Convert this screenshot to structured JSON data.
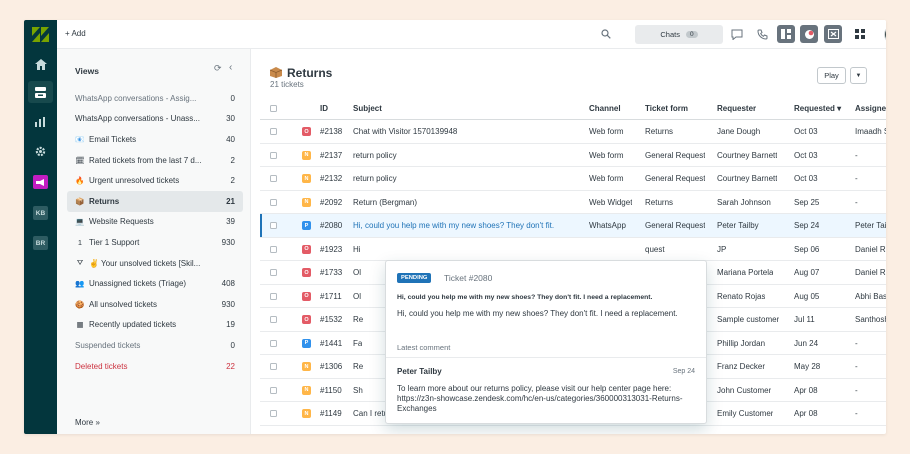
{
  "topbar": {
    "add_label": "+ Add",
    "chats_label": "Chats",
    "chats_count": "0"
  },
  "rail": {
    "kb_label": "KB",
    "br_label": "BR"
  },
  "views": {
    "title": "Views",
    "more_label": "More »",
    "items": [
      {
        "icon": "",
        "label": "WhatsApp conversations - Assig...",
        "count": "0",
        "style": "gray"
      },
      {
        "icon": "",
        "label": "WhatsApp conversations - Unass...",
        "count": "30",
        "style": ""
      },
      {
        "icon": "📧",
        "label": "Email Tickets",
        "count": "40",
        "style": ""
      },
      {
        "icon": "🗓",
        "label": "Rated tickets from the last 7 d...",
        "count": "2",
        "style": ""
      },
      {
        "icon": "🔥",
        "label": "Urgent unresolved tickets",
        "count": "2",
        "style": ""
      },
      {
        "icon": "📦",
        "label": "Returns",
        "count": "21",
        "style": "active"
      },
      {
        "icon": "💻",
        "label": "Website Requests",
        "count": "39",
        "style": ""
      },
      {
        "icon": "1",
        "label": "Tier 1 Support",
        "count": "930",
        "style": ""
      },
      {
        "icon": "⛛",
        "label": "✌ Your unsolved tickets [Skil...",
        "count": "",
        "style": ""
      },
      {
        "icon": "👥",
        "label": "Unassigned tickets (Triage)",
        "count": "408",
        "style": ""
      },
      {
        "icon": "🍪",
        "label": "All unsolved tickets",
        "count": "930",
        "style": ""
      },
      {
        "icon": "▦",
        "label": "Recently updated tickets",
        "count": "19",
        "style": ""
      },
      {
        "icon": "",
        "label": "Suspended tickets",
        "count": "0",
        "style": "gray"
      },
      {
        "icon": "",
        "label": "Deleted tickets",
        "count": "22",
        "style": "red"
      }
    ]
  },
  "main": {
    "title": "Returns",
    "subtitle": "21 tickets",
    "play_label": "Play",
    "columns": [
      "ID",
      "Subject",
      "Channel",
      "Ticket form",
      "Requester",
      "Requested ▾",
      "Assignee"
    ],
    "rows": [
      {
        "status": "O",
        "status_color": "#e35b66",
        "id": "#2138",
        "subject": "Chat with Visitor 1570139948",
        "channel": "Web form",
        "form": "Returns",
        "requester": "Jane Dough",
        "requested": "Oct 03",
        "assignee": "Imaadh S"
      },
      {
        "status": "N",
        "status_color": "#ffb648",
        "id": "#2137",
        "subject": "return policy",
        "channel": "Web form",
        "form": "General Request",
        "requester": "Courtney Barnett",
        "requested": "Oct 03",
        "assignee": "-"
      },
      {
        "status": "N",
        "status_color": "#ffb648",
        "id": "#2132",
        "subject": "return policy",
        "channel": "Web form",
        "form": "General Request",
        "requester": "Courtney Barnett",
        "requested": "Oct 03",
        "assignee": "-"
      },
      {
        "status": "N",
        "status_color": "#ffb648",
        "id": "#2092",
        "subject": "Return (Bergman)",
        "channel": "Web Widget",
        "form": "Returns",
        "requester": "Sarah Johnson",
        "requested": "Sep 25",
        "assignee": "-"
      },
      {
        "status": "P",
        "status_color": "#3091ec",
        "id": "#2080",
        "subject": "Hi, could you help me with my new shoes? They don't fit.",
        "channel": "WhatsApp",
        "form": "General Request",
        "requester": "Peter Tailby",
        "requested": "Sep 24",
        "assignee": "Peter Tail"
      },
      {
        "status": "O",
        "status_color": "#e35b66",
        "id": "#1923",
        "subject": "Hi",
        "channel": "",
        "form": "quest",
        "requester": "JP",
        "requested": "Sep 06",
        "assignee": "Daniel Ru"
      },
      {
        "status": "O",
        "status_color": "#e35b66",
        "id": "#1733",
        "subject": "Ol",
        "channel": "",
        "form": "atus",
        "requester": "Mariana Portela",
        "requested": "Aug 07",
        "assignee": "Daniel Ru"
      },
      {
        "status": "O",
        "status_color": "#e35b66",
        "id": "#1711",
        "subject": "Ol",
        "channel": "",
        "form": "",
        "requester": "Renato Rojas",
        "requested": "Aug 05",
        "assignee": "Abhi Bas"
      },
      {
        "status": "O",
        "status_color": "#e35b66",
        "id": "#1532",
        "subject": "Re",
        "channel": "",
        "form": "",
        "requester": "Sample customer",
        "requested": "Jul 11",
        "assignee": "Santhosh"
      },
      {
        "status": "P",
        "status_color": "#3091ec",
        "id": "#1441",
        "subject": "Fa",
        "channel": "",
        "form": "quest",
        "requester": "Phillip Jordan",
        "requested": "Jun 24",
        "assignee": "-"
      },
      {
        "status": "N",
        "status_color": "#ffb648",
        "id": "#1306",
        "subject": "Re",
        "channel": "",
        "form": "",
        "requester": "Franz Decker",
        "requested": "May 28",
        "assignee": "-"
      },
      {
        "status": "N",
        "status_color": "#ffb648",
        "id": "#1150",
        "subject": "Sh",
        "channel": "",
        "form": "",
        "requester": "John Customer",
        "requested": "Apr 08",
        "assignee": "-"
      },
      {
        "status": "N",
        "status_color": "#ffb648",
        "id": "#1149",
        "subject": "Can I return my shoes?",
        "channel": "Web Widget",
        "form": "Returns",
        "requester": "Emily Customer",
        "requested": "Apr 08",
        "assignee": "-"
      }
    ]
  },
  "popover": {
    "badge": "PENDING",
    "ticket_no": "Ticket #2080",
    "subject": "Hi, could you help me with my new shoes? They don't fit. I need a replacement.",
    "description": "Hi, could you help me with my new shoes? They don't fit. I need a replacement.",
    "latest_label": "Latest comment",
    "author": "Peter Tailby",
    "date": "Sep 24",
    "body": "To learn more about our returns policy, please visit our help center page here: https://z3n-showcase.zendesk.com/hc/en-us/categories/360000313031-Returns-Exchanges"
  },
  "colors": {
    "rail": "#03363d",
    "accent": "#1f73b7",
    "open": "#e35b66",
    "new": "#ffb648",
    "pending": "#3091ec"
  }
}
